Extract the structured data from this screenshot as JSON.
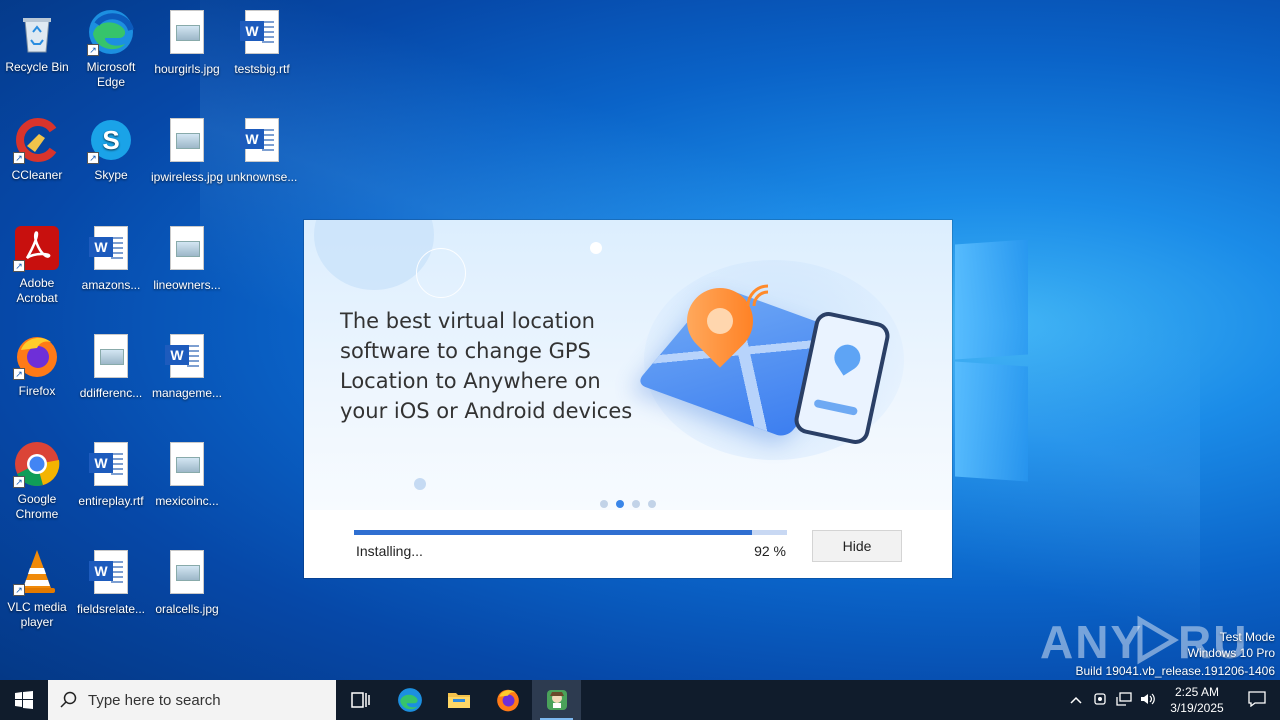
{
  "desktop": {
    "icons": [
      {
        "label": "Recycle Bin",
        "icon": "recycle-bin-icon"
      },
      {
        "label": "Microsoft Edge",
        "icon": "edge-icon"
      },
      {
        "label": "hourgirls.jpg",
        "icon": "image-file-icon"
      },
      {
        "label": "testsbig.rtf",
        "icon": "word-doc-icon"
      },
      {
        "label": "CCleaner",
        "icon": "ccleaner-icon"
      },
      {
        "label": "Skype",
        "icon": "skype-icon"
      },
      {
        "label": "ipwireless.jpg",
        "icon": "image-file-icon"
      },
      {
        "label": "unknownse...",
        "icon": "word-doc-icon"
      },
      {
        "label": "Adobe Acrobat",
        "icon": "acrobat-icon"
      },
      {
        "label": "amazons...",
        "icon": "word-doc-icon"
      },
      {
        "label": "lineowners...",
        "icon": "image-file-icon"
      },
      {
        "label": "Firefox",
        "icon": "firefox-icon"
      },
      {
        "label": "ddifferenc...",
        "icon": "image-file-icon"
      },
      {
        "label": "manageme...",
        "icon": "word-doc-icon"
      },
      {
        "label": "Google Chrome",
        "icon": "chrome-icon"
      },
      {
        "label": "entireplay.rtf",
        "icon": "word-doc-icon"
      },
      {
        "label": "mexicoinc...",
        "icon": "image-file-icon"
      },
      {
        "label": "VLC media player",
        "icon": "vlc-icon"
      },
      {
        "label": "fieldsrelate...",
        "icon": "word-doc-icon"
      },
      {
        "label": "oralcells.jpg",
        "icon": "image-file-icon"
      }
    ]
  },
  "installer": {
    "headline": "The best virtual location software to change GPS Location to Anywhere on your iOS or Android devices",
    "carousel_pages": 4,
    "carousel_active_index": 1,
    "status_text": "Installing...",
    "progress_percent": 92,
    "progress_label": "92 %",
    "hide_button": "Hide"
  },
  "watermark": {
    "brand": "ANY RUN",
    "line1": "Test Mode",
    "line2": "Windows 10 Pro",
    "line3": "Build 19041.vb_release.191206-1406"
  },
  "taskbar": {
    "search_placeholder": "Type here to search",
    "pinned": [
      "task-view-icon",
      "edge-icon",
      "file-explorer-icon",
      "firefox-icon",
      "installer-app-icon"
    ],
    "time": "2:25 AM",
    "date": "3/19/2025"
  }
}
